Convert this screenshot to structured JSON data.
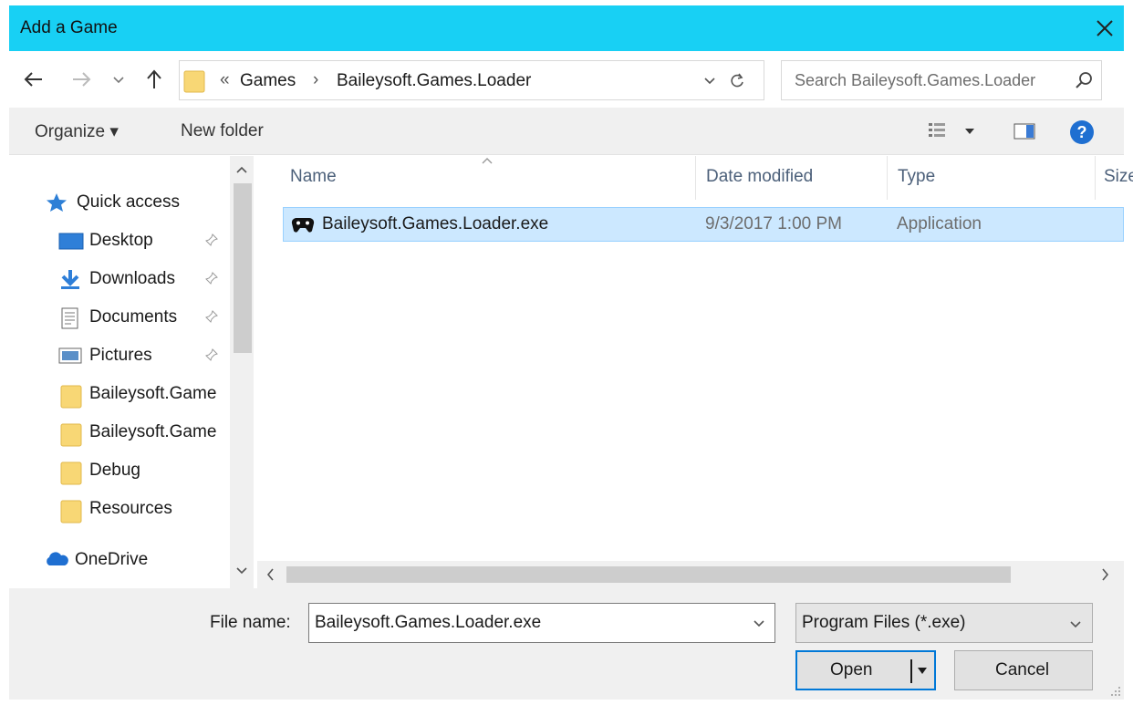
{
  "window": {
    "title": "Add a Game"
  },
  "address": {
    "overflow": "«",
    "crumbs": [
      "Games",
      "Baileysoft.Games.Loader"
    ],
    "separator": "›"
  },
  "search": {
    "placeholder": "Search Baileysoft.Games.Loader"
  },
  "toolbar": {
    "organize_label": "Organize ▾",
    "new_folder_label": "New folder"
  },
  "nav": {
    "quick_access": "Quick access",
    "items": [
      {
        "label": "Desktop",
        "icon": "desktop-icon",
        "pinned": true
      },
      {
        "label": "Downloads",
        "icon": "downloads-icon",
        "pinned": true
      },
      {
        "label": "Documents",
        "icon": "documents-icon",
        "pinned": true
      },
      {
        "label": "Pictures",
        "icon": "pictures-icon",
        "pinned": true
      },
      {
        "label": "Baileysoft.Game",
        "icon": "folder-icon",
        "pinned": false
      },
      {
        "label": "Baileysoft.Game",
        "icon": "folder-icon",
        "pinned": false
      },
      {
        "label": "Debug",
        "icon": "folder-icon",
        "pinned": false
      },
      {
        "label": "Resources",
        "icon": "folder-icon",
        "pinned": false
      }
    ],
    "onedrive": "OneDrive"
  },
  "files": {
    "columns": [
      "Name",
      "Date modified",
      "Type",
      "Size"
    ],
    "rows": [
      {
        "name": "Baileysoft.Games.Loader.exe",
        "date": "9/3/2017 1:00 PM",
        "type": "Application",
        "selected": true
      }
    ]
  },
  "footer": {
    "file_name_label": "File name:",
    "file_name_value": "Baileysoft.Games.Loader.exe",
    "filter_value": "Program Files (*.exe)",
    "open_label": "Open",
    "cancel_label": "Cancel"
  },
  "colors": {
    "titlebar": "#18d0f4",
    "selection": "#cce8ff",
    "accent": "#0078d7",
    "folder": "#f8d775"
  }
}
